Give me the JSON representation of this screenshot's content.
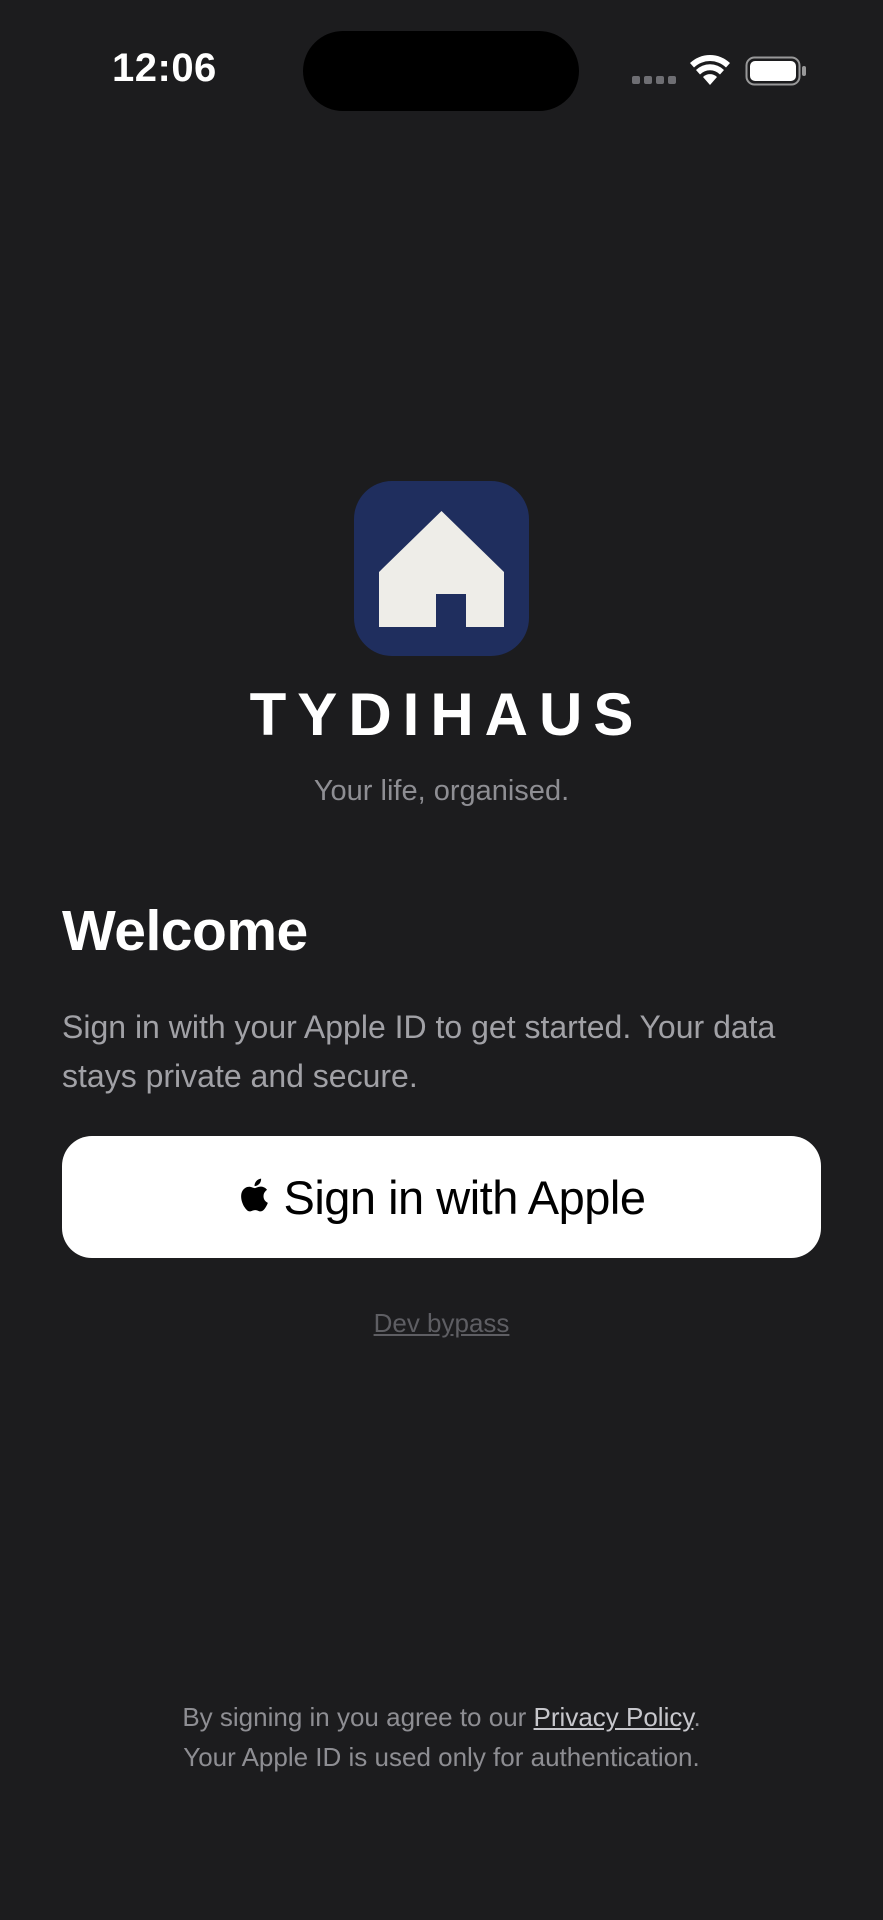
{
  "status_bar": {
    "time": "12:06",
    "icons": [
      "signal-icon",
      "wifi-icon",
      "battery-icon"
    ]
  },
  "brand": {
    "logo_icon": "house-icon",
    "name": "TYDIHAUS",
    "tagline": "Your life, organised.",
    "logo_bg": "#1f2e5e",
    "logo_fg": "#eeede8"
  },
  "welcome": {
    "title": "Welcome",
    "body": "Sign in with your Apple ID to get started. Your data stays private and secure."
  },
  "signin_button": {
    "icon": "apple-icon",
    "label": "Sign in with Apple"
  },
  "dev_bypass": {
    "label": "Dev bypass"
  },
  "footer": {
    "line1_prefix": "By signing in you agree to our ",
    "privacy_link": "Privacy Policy",
    "line1_suffix": ".",
    "line2": "Your Apple ID is used only for authentication."
  },
  "colors": {
    "background": "#1c1c1e",
    "button_bg": "#ffffff",
    "secondary_text": "#8e8e93"
  }
}
